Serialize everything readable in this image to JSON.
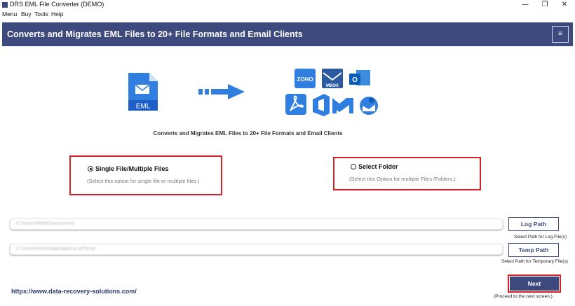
{
  "window": {
    "title": "DRS EML File Converter (DEMO)",
    "minimize": "—",
    "maximize": "❐",
    "close": "✕"
  },
  "menu": {
    "items": [
      "Menu",
      "Buy",
      "Tools",
      "Help"
    ]
  },
  "header": {
    "title": "Converts and Migrates EML Files to 20+ File Formats and Email Clients",
    "menu_icon": "≡"
  },
  "hero": {
    "source_label": "EML",
    "logo_text": {
      "zoho": "ZOHO",
      "mbox": "MBOX",
      "outlook": "O"
    },
    "subtitle": "Converts and Migrates EML Files to 20+ File Formats and Email Clients"
  },
  "options": {
    "single": {
      "label": "Single File/Multiple Files",
      "hint": "(Select this option for single file or multiple files.)",
      "selected": true
    },
    "folder": {
      "label": "Select Folder",
      "hint": "(Select this Option for multiple Files /Folders.)",
      "selected": false
    }
  },
  "log": {
    "path_value": "C:\\Users\\Rohit\\Documents",
    "button": "Log Path",
    "caption": "Select Path for Log File(s)"
  },
  "temp": {
    "path_value": "C:\\Users\\Rohit\\AppData\\Local\\Temp\\",
    "button": "Temp Path",
    "caption": "Select Path for Temporary File(s)"
  },
  "footer": {
    "url": "https://www.data-recovery-solutions.com/",
    "next": "Next",
    "next_caption": "(Proceed to the next screen.)"
  },
  "colors": {
    "brand": "#3e4a7e",
    "highlight": "#d6202a",
    "icon_blue": "#2f7ee0"
  }
}
